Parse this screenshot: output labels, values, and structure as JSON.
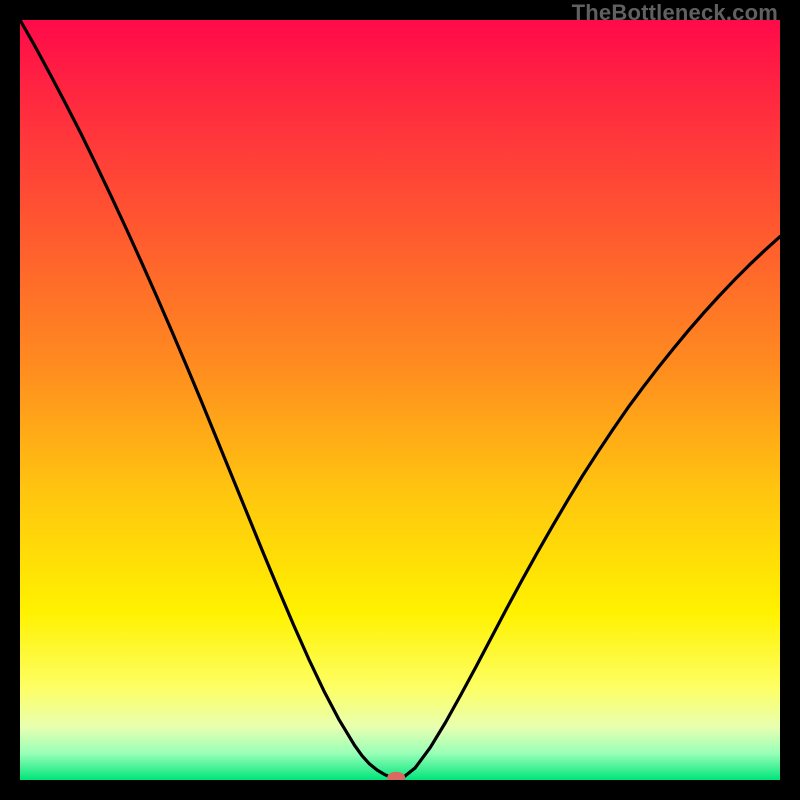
{
  "watermark": "TheBottleneck.com",
  "colors": {
    "frame": "#000000",
    "curve": "#000000",
    "marker": "#d96a5f",
    "gradient_stops": [
      {
        "offset": 0.0,
        "color": "#ff0a4a"
      },
      {
        "offset": 0.12,
        "color": "#ff2d3e"
      },
      {
        "offset": 0.28,
        "color": "#ff5a2f"
      },
      {
        "offset": 0.45,
        "color": "#ff8a20"
      },
      {
        "offset": 0.62,
        "color": "#ffc50f"
      },
      {
        "offset": 0.78,
        "color": "#fff200"
      },
      {
        "offset": 0.88,
        "color": "#fdff66"
      },
      {
        "offset": 0.93,
        "color": "#e8ffb0"
      },
      {
        "offset": 0.965,
        "color": "#98ffb8"
      },
      {
        "offset": 1.0,
        "color": "#00e57a"
      }
    ]
  },
  "chart_data": {
    "type": "line",
    "title": "",
    "xlabel": "",
    "ylabel": "",
    "xlim": [
      0,
      100
    ],
    "ylim": [
      0,
      100
    ],
    "x": [
      0,
      2,
      4,
      6,
      8,
      10,
      12,
      14,
      16,
      18,
      20,
      22,
      24,
      26,
      28,
      30,
      32,
      34,
      36,
      38,
      40,
      42,
      44,
      45,
      46,
      47,
      48,
      49,
      49.5,
      50,
      52,
      54,
      56,
      58,
      60,
      62,
      64,
      66,
      68,
      70,
      72,
      74,
      76,
      78,
      80,
      82,
      84,
      86,
      88,
      90,
      92,
      94,
      96,
      98,
      100
    ],
    "values": [
      100,
      96.5,
      92.8,
      89.0,
      85.1,
      81.0,
      76.8,
      72.5,
      68.1,
      63.6,
      59.0,
      54.3,
      49.5,
      44.6,
      39.7,
      34.8,
      29.9,
      25.1,
      20.4,
      15.9,
      11.7,
      7.9,
      4.6,
      3.2,
      2.1,
      1.3,
      0.7,
      0.3,
      0.1,
      0.0,
      1.6,
      4.3,
      7.6,
      11.2,
      14.9,
      18.7,
      22.5,
      26.2,
      29.8,
      33.3,
      36.7,
      40.0,
      43.1,
      46.1,
      49.0,
      51.7,
      54.3,
      56.8,
      59.2,
      61.5,
      63.7,
      65.8,
      67.8,
      69.7,
      71.5
    ],
    "minimum_marker": {
      "x": 49.5,
      "y": 0.3
    }
  }
}
